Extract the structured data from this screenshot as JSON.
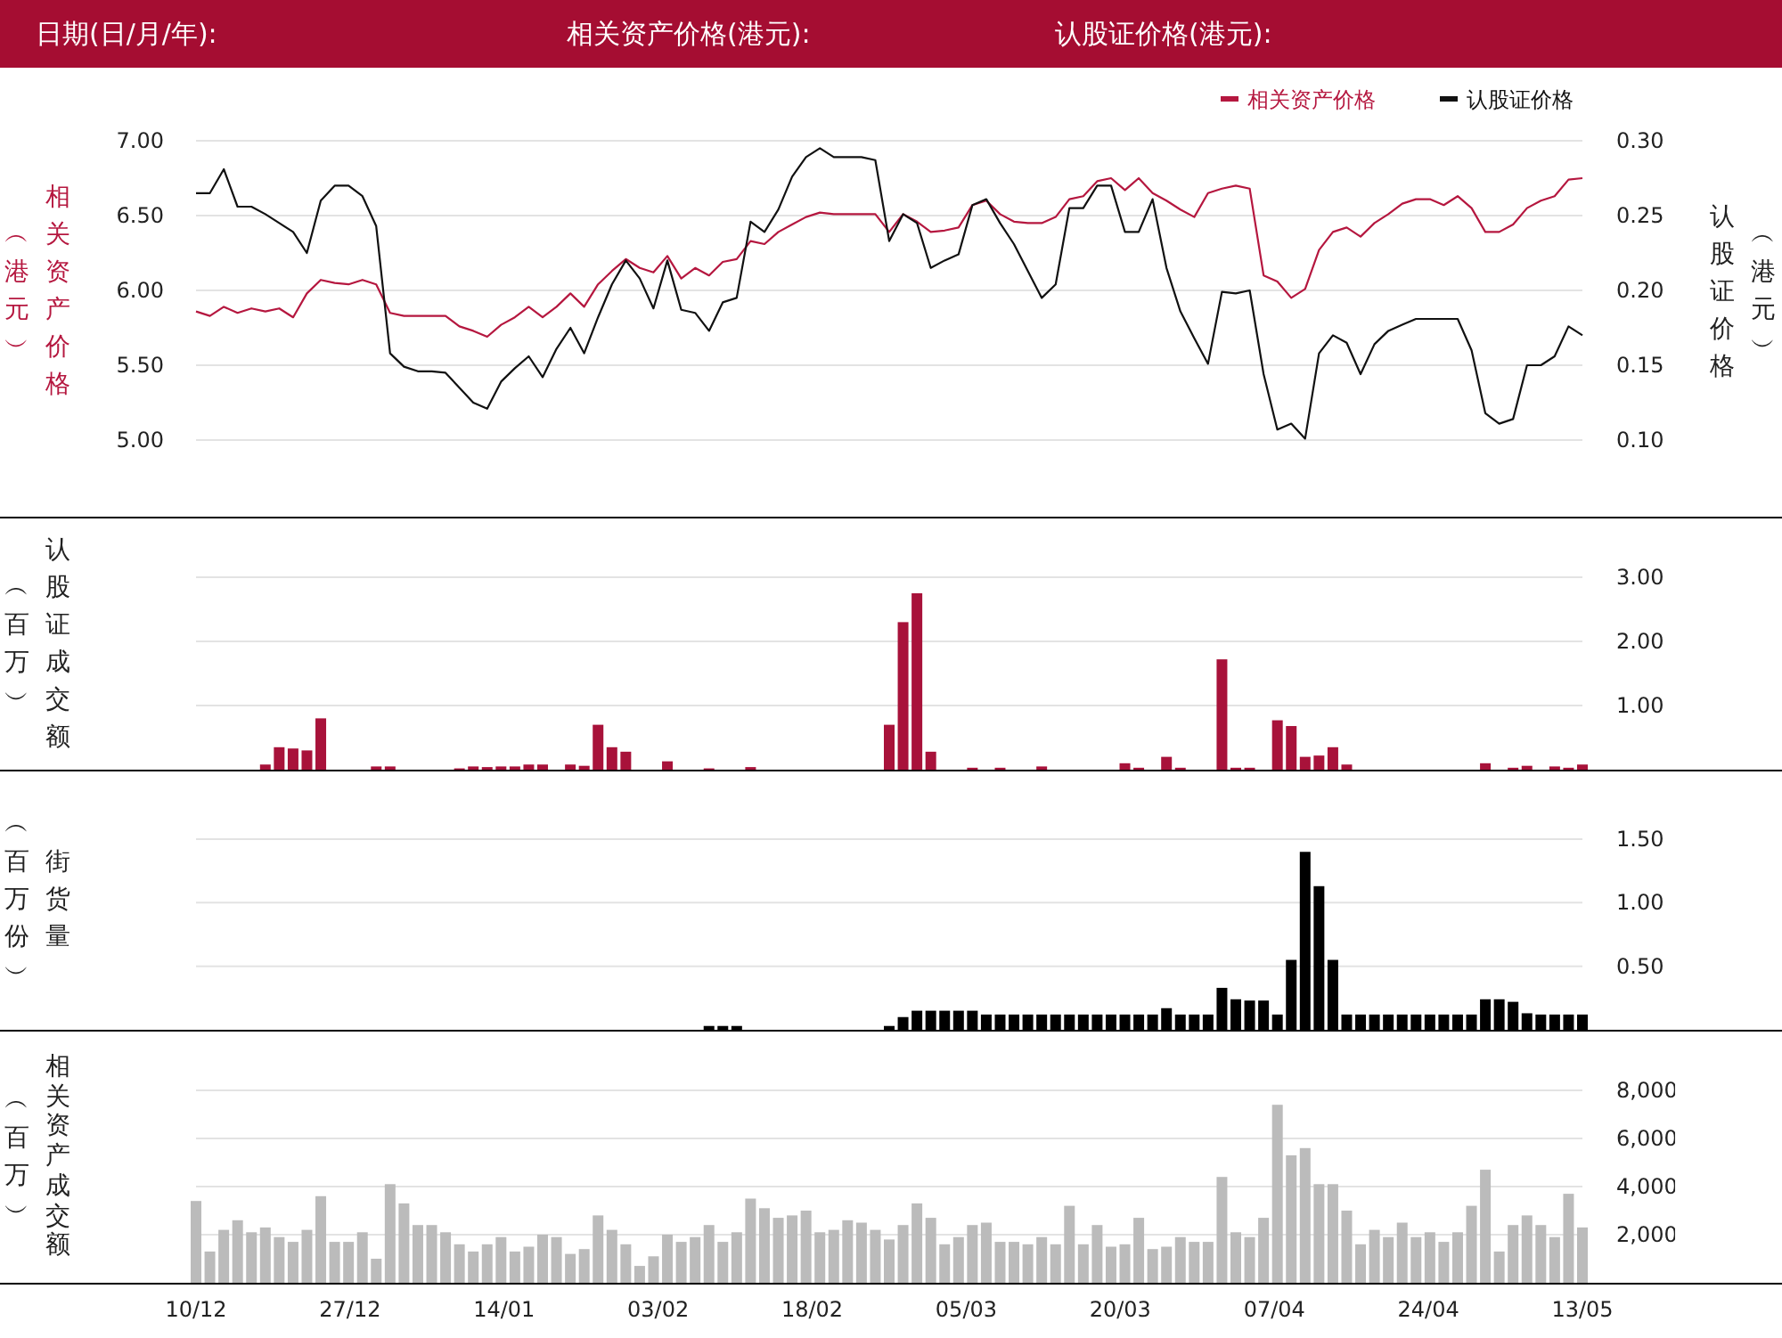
{
  "header": {
    "labels": [
      "日期(日/月/年):",
      "相关资产价格(港元):",
      "认股证价格(港元):"
    ]
  },
  "price_panel": {
    "left_axis": {
      "title": "相关资产价格",
      "unit": "︵港元︶"
    },
    "right_axis": {
      "title": "认股证价格",
      "unit": "︵港元︶"
    },
    "charts": [
      {
        "chart_data": {
          "type": "line",
          "grid": true,
          "ylim": [
            5,
            7
          ],
          "yticks": [
            {
              "value": 5,
              "label": "5.00"
            },
            {
              "value": 5.5,
              "label": "5.50"
            },
            {
              "value": 6,
              "label": "6.00"
            },
            {
              "value": 6.5,
              "label": "6.50"
            },
            {
              "value": 7,
              "label": "7.00"
            }
          ],
          "series": [
            {
              "name": "相关资产价格",
              "color": "#b5173f",
              "values": [
                5.86,
                5.83,
                5.89,
                5.85,
                5.88,
                5.86,
                5.88,
                5.82,
                5.98,
                6.07,
                6.05,
                6.04,
                6.07,
                6.04,
                5.85,
                5.83,
                5.83,
                5.83,
                5.83,
                5.76,
                5.73,
                5.69,
                5.77,
                5.82,
                5.89,
                5.82,
                5.89,
                5.98,
                5.89,
                6.04,
                6.13,
                6.21,
                6.15,
                6.12,
                6.23,
                6.08,
                6.15,
                6.1,
                6.19,
                6.21,
                6.33,
                6.31,
                6.39,
                6.44,
                6.49,
                6.52,
                6.51,
                6.51,
                6.51,
                6.51,
                6.39,
                6.51,
                6.46,
                6.39,
                6.4,
                6.42,
                6.57,
                6.6,
                6.51,
                6.46,
                6.45,
                6.45,
                6.49,
                6.61,
                6.63,
                6.73,
                6.75,
                6.67,
                6.75,
                6.65,
                6.6,
                6.54,
                6.49,
                6.65,
                6.68,
                6.7,
                6.68,
                6.1,
                6.06,
                5.95,
                6.01,
                6.27,
                6.39,
                6.42,
                6.36,
                6.45,
                6.51,
                6.58,
                6.61,
                6.61,
                6.57,
                6.63,
                6.55,
                6.39,
                6.39,
                6.44,
                6.55,
                6.6,
                6.63,
                6.74,
                6.75
              ]
            }
          ]
        }
      },
      {
        "chart_data": {
          "type": "line",
          "ylim": [
            0.1,
            0.3
          ],
          "yticks": [
            {
              "value": 0.1,
              "label": "0.10"
            },
            {
              "value": 0.15,
              "label": "0.15"
            },
            {
              "value": 0.2,
              "label": "0.20"
            },
            {
              "value": 0.25,
              "label": "0.25"
            },
            {
              "value": 0.3,
              "label": "0.30"
            }
          ],
          "series": [
            {
              "name": "认股证价格",
              "color": "#111111",
              "values": [
                0.265,
                0.265,
                0.281,
                0.256,
                0.256,
                0.251,
                0.245,
                0.239,
                0.225,
                0.26,
                0.27,
                0.27,
                0.263,
                0.243,
                0.158,
                0.149,
                0.146,
                0.146,
                0.145,
                0.135,
                0.125,
                0.121,
                0.139,
                0.148,
                0.156,
                0.142,
                0.161,
                0.175,
                0.158,
                0.182,
                0.204,
                0.22,
                0.208,
                0.188,
                0.22,
                0.187,
                0.185,
                0.173,
                0.192,
                0.195,
                0.246,
                0.239,
                0.254,
                0.276,
                0.289,
                0.295,
                0.289,
                0.289,
                0.289,
                0.287,
                0.233,
                0.251,
                0.245,
                0.215,
                0.22,
                0.224,
                0.257,
                0.261,
                0.245,
                0.231,
                0.213,
                0.195,
                0.204,
                0.255,
                0.255,
                0.27,
                0.27,
                0.239,
                0.239,
                0.261,
                0.215,
                0.186,
                0.168,
                0.151,
                0.199,
                0.198,
                0.2,
                0.144,
                0.107,
                0.111,
                0.101,
                0.158,
                0.17,
                0.165,
                0.144,
                0.164,
                0.173,
                0.177,
                0.181,
                0.181,
                0.181,
                0.181,
                0.16,
                0.118,
                0.111,
                0.114,
                0.15,
                0.15,
                0.156,
                0.176,
                0.17
              ]
            }
          ]
        }
      }
    ]
  },
  "volume_panels": [
    {
      "unit": "︵百万︶",
      "chart_data": {
        "type": "bar",
        "grid": true,
        "ylim": [
          0,
          3
        ],
        "yticks": [
          {
            "value": 1,
            "label": "1.00"
          },
          {
            "value": 2,
            "label": "2.00"
          },
          {
            "value": 3,
            "label": "3.00"
          }
        ],
        "series": [
          {
            "name": "认股证成交额",
            "color": "#a8123a",
            "values": [
              0,
              0,
              0,
              0,
              0,
              0.08,
              0.35,
              0.33,
              0.3,
              0.8,
              0,
              0,
              0,
              0.05,
              0.05,
              0,
              0,
              0,
              0,
              0.02,
              0.05,
              0.04,
              0.05,
              0.05,
              0.08,
              0.08,
              0,
              0.08,
              0.06,
              0.7,
              0.35,
              0.28,
              0,
              0,
              0.13,
              0,
              0,
              0.02,
              0,
              0,
              0.04,
              0,
              0,
              0,
              0,
              0,
              0,
              0,
              0,
              0,
              0.7,
              2.3,
              2.75,
              0.28,
              0,
              0,
              0.03,
              0,
              0.03,
              0,
              0,
              0.05,
              0,
              0,
              0,
              0,
              0,
              0.1,
              0.03,
              0,
              0.2,
              0.03,
              0,
              0,
              1.72,
              0.03,
              0.03,
              0,
              0.77,
              0.68,
              0.2,
              0.22,
              0.35,
              0.08,
              0,
              0,
              0,
              0,
              0,
              0,
              0,
              0,
              0,
              0.1,
              0,
              0.03,
              0.06,
              0,
              0.05,
              0.03,
              0.08
            ]
          }
        ]
      }
    },
    {
      "unit": "︵百万份︶",
      "chart_data": {
        "type": "bar",
        "grid": true,
        "ylim": [
          0,
          1.5
        ],
        "yticks": [
          {
            "value": 0.5,
            "label": "0.50"
          },
          {
            "value": 1,
            "label": "1.00"
          },
          {
            "value": 1.5,
            "label": "1.50"
          }
        ],
        "series": [
          {
            "name": "街货量",
            "color": "#000000",
            "values": [
              0,
              0,
              0,
              0,
              0,
              0,
              0,
              0,
              0,
              0,
              0,
              0,
              0,
              0,
              0,
              0,
              0,
              0,
              0,
              0,
              0,
              0,
              0,
              0,
              0,
              0,
              0,
              0,
              0,
              0,
              0,
              0,
              0,
              0,
              0,
              0,
              0,
              0.03,
              0.03,
              0.03,
              0,
              0,
              0,
              0,
              0,
              0,
              0,
              0,
              0,
              0,
              0.03,
              0.1,
              0.15,
              0.15,
              0.15,
              0.15,
              0.15,
              0.12,
              0.12,
              0.12,
              0.12,
              0.12,
              0.12,
              0.12,
              0.12,
              0.12,
              0.12,
              0.12,
              0.12,
              0.12,
              0.17,
              0.12,
              0.12,
              0.12,
              0.33,
              0.24,
              0.23,
              0.23,
              0.12,
              0.55,
              1.4,
              1.13,
              0.55,
              0.12,
              0.12,
              0.12,
              0.12,
              0.12,
              0.12,
              0.12,
              0.12,
              0.12,
              0.12,
              0.24,
              0.24,
              0.22,
              0.13,
              0.12,
              0.12,
              0.12,
              0.12
            ]
          }
        ]
      }
    },
    {
      "unit": "︵百万︶",
      "chart_data": {
        "type": "bar",
        "grid": true,
        "ylim": [
          0,
          8000
        ],
        "yticks": [
          {
            "value": 2000,
            "label": "2,000"
          },
          {
            "value": 4000,
            "label": "4,000"
          },
          {
            "value": 6000,
            "label": "6,000"
          },
          {
            "value": 8000,
            "label": "8,000"
          }
        ],
        "series": [
          {
            "name": "相关资产成交额",
            "color": "#bbbbbb",
            "values": [
              3400,
              1300,
              2200,
              2600,
              2100,
              2300,
              1900,
              1700,
              2200,
              3600,
              1700,
              1700,
              2100,
              1000,
              4100,
              3300,
              2400,
              2400,
              2100,
              1600,
              1300,
              1600,
              1900,
              1300,
              1500,
              2000,
              1900,
              1200,
              1400,
              2800,
              2200,
              1600,
              700,
              1100,
              2000,
              1700,
              1900,
              2400,
              1700,
              2100,
              3500,
              3100,
              2700,
              2800,
              3000,
              2100,
              2200,
              2600,
              2500,
              2200,
              1800,
              2400,
              3300,
              2700,
              1600,
              1900,
              2400,
              2500,
              1700,
              1700,
              1600,
              1900,
              1600,
              3200,
              1600,
              2400,
              1500,
              1600,
              2700,
              1400,
              1500,
              1900,
              1700,
              1700,
              4400,
              2100,
              1900,
              2700,
              7400,
              5300,
              5600,
              4100,
              4100,
              3000,
              1600,
              2200,
              1900,
              2500,
              1900,
              2100,
              1700,
              2100,
              3200,
              4700,
              1300,
              2400,
              2800,
              2400,
              1900,
              3700,
              2300
            ]
          }
        ]
      }
    }
  ],
  "date_axis": {
    "labels": [
      "10/12",
      "27/12",
      "14/01",
      "03/02",
      "18/02",
      "05/03",
      "20/03",
      "07/04",
      "24/04",
      "13/05"
    ]
  }
}
